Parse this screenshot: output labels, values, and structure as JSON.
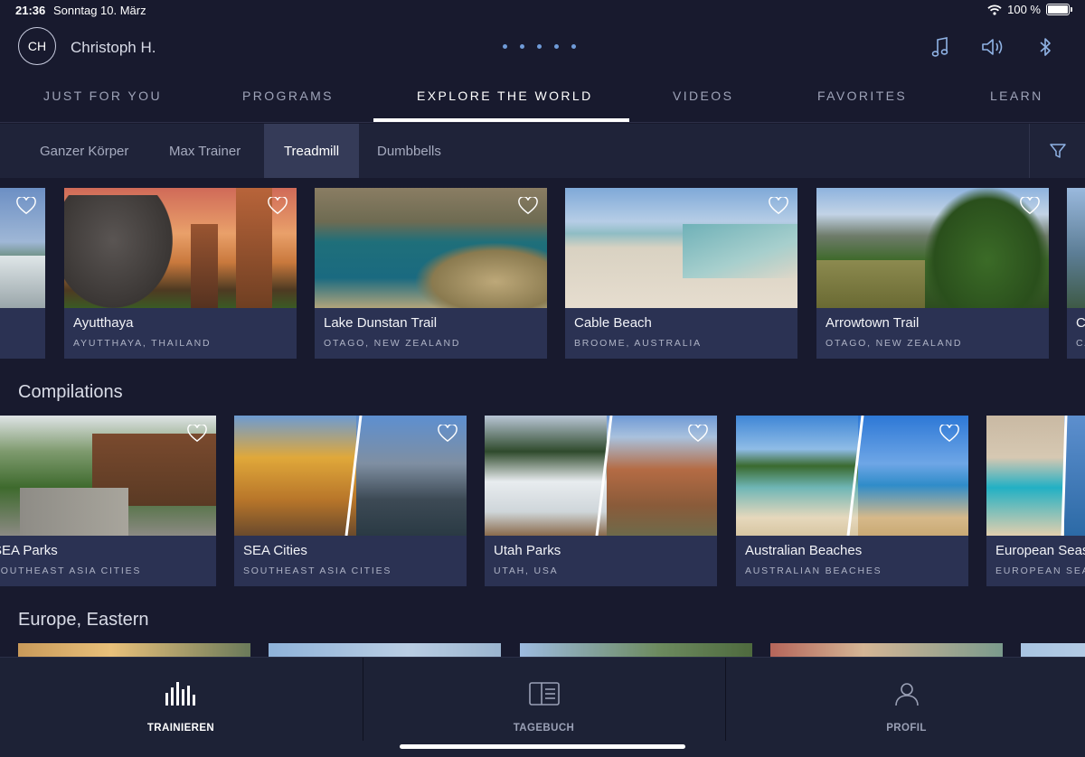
{
  "status_bar": {
    "time": "21:36",
    "date": "Sonntag 10. März",
    "battery": "100 %"
  },
  "header": {
    "avatar_initials": "CH",
    "username": "Christoph H."
  },
  "nav_tabs": [
    {
      "label": "JUST FOR YOU"
    },
    {
      "label": "PROGRAMS"
    },
    {
      "label": "EXPLORE THE WORLD",
      "active": true
    },
    {
      "label": "VIDEOS"
    },
    {
      "label": "FAVORITES"
    },
    {
      "label": "LEARN"
    }
  ],
  "filter_chips": [
    {
      "label": "Ganzer Körper"
    },
    {
      "label": "Max Trainer"
    },
    {
      "label": "Treadmill",
      "active": true
    },
    {
      "label": "Dumbbells"
    }
  ],
  "featured_cards": [
    {
      "title": "Ayutthaya",
      "subtitle": "AYUTTHAYA, THAILAND"
    },
    {
      "title": "Lake Dunstan Trail",
      "subtitle": "OTAGO, NEW ZEALAND"
    },
    {
      "title": "Cable Beach",
      "subtitle": "BROOME, AUSTRALIA"
    },
    {
      "title": "Arrowtown Trail",
      "subtitle": "OTAGO, NEW ZEALAND"
    },
    {
      "title": "C",
      "subtitle": "CA"
    }
  ],
  "compilations": {
    "title": "Compilations",
    "cards": [
      {
        "title": "SEA Parks",
        "subtitle": "SOUTHEAST ASIA CITIES"
      },
      {
        "title": "SEA Cities",
        "subtitle": "SOUTHEAST ASIA CITIES"
      },
      {
        "title": "Utah Parks",
        "subtitle": "UTAH, USA"
      },
      {
        "title": "Australian Beaches",
        "subtitle": "AUSTRALIAN BEACHES"
      },
      {
        "title": "European Seas",
        "subtitle": "EUROPEAN SEA"
      }
    ]
  },
  "europe_eastern": {
    "title": "Europe, Eastern"
  },
  "bottom_tabs": [
    {
      "label": "TRAINIEREN",
      "icon": "equalizer-icon",
      "active": true
    },
    {
      "label": "TAGEBUCH",
      "icon": "journal-icon"
    },
    {
      "label": "PROFIL",
      "icon": "person-icon"
    }
  ],
  "colors": {
    "background": "#181a2e",
    "card": "#2b3253",
    "accent_dots": "#6f9bd8",
    "chip_active": "#353b58"
  }
}
